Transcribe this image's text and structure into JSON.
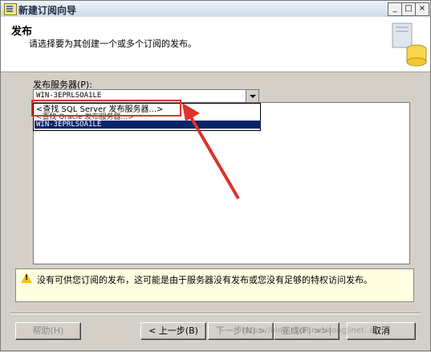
{
  "window": {
    "title": "新建订阅向导",
    "buttons": {
      "min": "_",
      "max": "□",
      "close": "×"
    }
  },
  "header": {
    "title": "发布",
    "subtitle": "请选择要为其创建一个或多个订阅的发布。"
  },
  "publisher": {
    "label": "发布服务器(P):",
    "selected_value": "WIN-3EPRLSOA1LE",
    "dropdown_items": [
      "<查找 SQL Server 发布服务器...>",
      "<查找 Oracle 发布服务器...>",
      "WIN-3EPRLSOA1LE"
    ]
  },
  "warning": {
    "icon": "warning-icon",
    "text": "没有可供您订阅的发布，这可能是由于服务器没有发布或您没有足够的特权访问发布。"
  },
  "footer": {
    "help": "帮助(H)",
    "back": "< 上一步(B)",
    "next": "下一步(N) >",
    "finish": "完成(F) >>|",
    "cancel": "取消"
  },
  "annotation": {
    "color": "#e0312a"
  },
  "watermark": "https://blog.csdn.net/songjinet..a"
}
